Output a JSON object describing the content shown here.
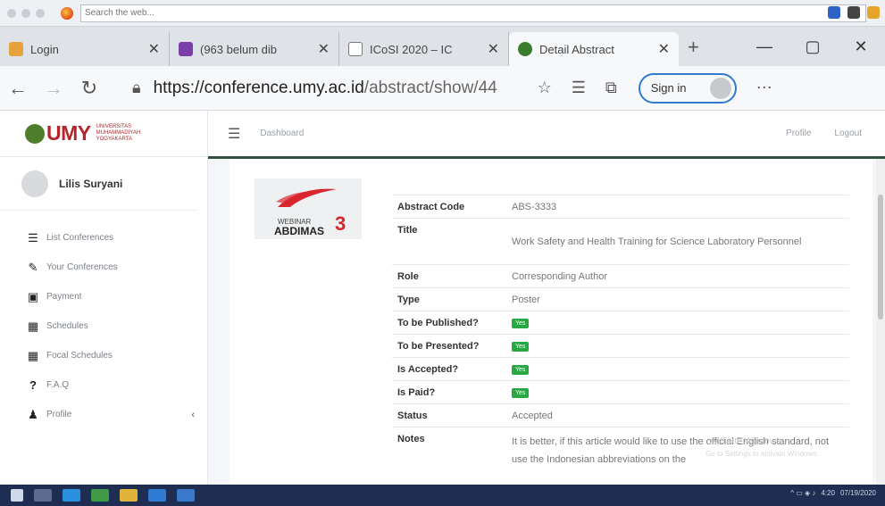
{
  "legacy_toolbar": {
    "search_placeholder": "Search the web..."
  },
  "tabs": [
    {
      "label": "Login",
      "color": "#e6a23c"
    },
    {
      "label": "(963 belum dib",
      "color": "#7a3ea8"
    },
    {
      "label": "ICoSI 2020 – IC",
      "color": "#ffffff"
    },
    {
      "label": "Detail Abstract",
      "color": "#3a7d2c",
      "active": true
    }
  ],
  "addressbar": {
    "url_domain": "https://conference.umy.ac.id",
    "url_path": "/abstract/show/44",
    "signin_label": "Sign in"
  },
  "brand": {
    "name": "UMY",
    "tagline": "UNIVERSITAS MUHAMMADIYAH YOGYAKARTA",
    "accent": "#b3252b"
  },
  "user": {
    "name": "Lilis Suryani"
  },
  "sidebar": {
    "items": [
      {
        "label": "List Conferences",
        "icon": "database-icon",
        "glyph": "☰"
      },
      {
        "label": "Your Conferences",
        "icon": "pencil-icon",
        "glyph": "✎"
      },
      {
        "label": "Payment",
        "icon": "money-icon",
        "glyph": "▣"
      },
      {
        "label": "Schedules",
        "icon": "calendar-icon",
        "glyph": "▦"
      },
      {
        "label": "Focal Schedules",
        "icon": "calendar-icon",
        "glyph": "▦"
      },
      {
        "label": "F.A.Q",
        "icon": "question-icon",
        "glyph": "?"
      },
      {
        "label": "Profile",
        "icon": "user-icon",
        "glyph": "♟"
      }
    ]
  },
  "header": {
    "breadcrumb": "Dashboard",
    "profile": "Profile",
    "logout": "Logout"
  },
  "logo": {
    "webinar": "WEBINAR",
    "abdimas": "ABDIMAS",
    "number": "3"
  },
  "detail": {
    "rows": [
      {
        "key": "Abstract Code",
        "value": "ABS-3333"
      },
      {
        "key": "Title",
        "value": "Work Safety and Health Training for Science Laboratory Personnel"
      },
      {
        "key": "Role",
        "value": "Corresponding Author"
      },
      {
        "key": "Type",
        "value": "Poster"
      },
      {
        "key": "To be Published?",
        "badge": "Yes"
      },
      {
        "key": "To be Presented?",
        "badge": "Yes"
      },
      {
        "key": "Is Accepted?",
        "badge": "Yes"
      },
      {
        "key": "Is Paid?",
        "badge": "Yes"
      },
      {
        "key": "Status",
        "value": "Accepted"
      },
      {
        "key": "Notes",
        "value": "It is better, if this article would like to use the official English standard, not use the Indonesian abbreviations on the"
      }
    ]
  },
  "watermark": {
    "line1": "Activate Windows",
    "line2": "Go to Settings to activate Windows."
  },
  "taskbar": {
    "time": "4:20",
    "date": "07/19/2020"
  }
}
